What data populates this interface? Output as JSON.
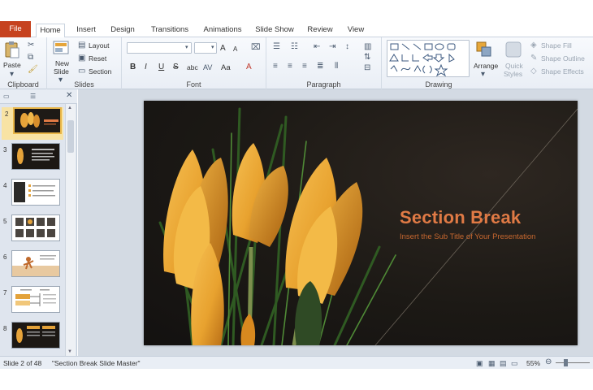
{
  "tabs": {
    "file": "File",
    "home": "Home",
    "insert": "Insert",
    "design": "Design",
    "transitions": "Transitions",
    "animations": "Animations",
    "slideshow": "Slide Show",
    "review": "Review",
    "view": "View"
  },
  "clipboard": {
    "paste": "Paste",
    "group": "Clipboard"
  },
  "slides": {
    "new_slide": "New",
    "new_slide2": "Slide",
    "layout": "Layout",
    "reset": "Reset",
    "section": "Section",
    "group": "Slides"
  },
  "font": {
    "group": "Font",
    "bold": "B",
    "italic": "I",
    "underline": "U",
    "strike": "S",
    "shadow": "abc",
    "grow": "A",
    "shrink": "A",
    "case": "Aa",
    "color": "A"
  },
  "paragraph": {
    "group": "Paragraph"
  },
  "drawing": {
    "group": "Drawing",
    "arrange": "Arrange",
    "quick_styles": "Quick",
    "quick_styles2": "Styles",
    "shape_fill": "Shape Fill",
    "shape_outline": "Shape Outline",
    "shape_effects": "Shape Effects"
  },
  "thumbnails": [
    "2",
    "3",
    "4",
    "5",
    "6",
    "7",
    "8"
  ],
  "slide": {
    "title": "Section  Break",
    "subtitle": "Insert the Sub Title of Your Presentation"
  },
  "status": {
    "slide_of": "Slide 2 of 48",
    "theme": "\"Section Break Slide Master\"",
    "zoom": "55%",
    "zoom_level": 0.55
  },
  "colors": {
    "file_tab": "#c6421f",
    "title": "#e07a45",
    "subtitle": "#c6672f",
    "selected_thumb": "#e8b547"
  }
}
